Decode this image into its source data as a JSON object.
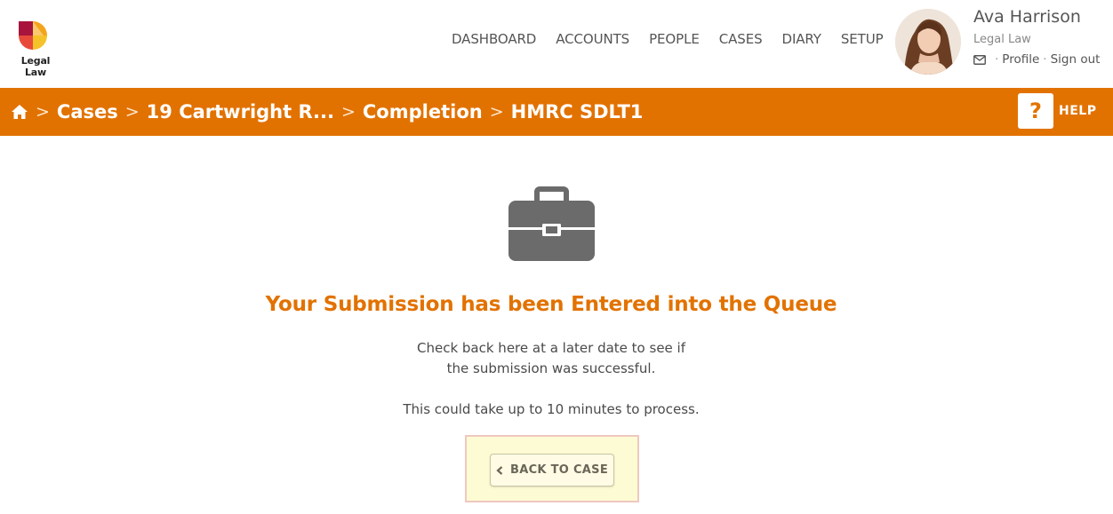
{
  "brand": {
    "name": "Legal Law"
  },
  "nav": {
    "items": [
      {
        "label": "DASHBOARD"
      },
      {
        "label": "ACCOUNTS"
      },
      {
        "label": "PEOPLE"
      },
      {
        "label": "CASES"
      },
      {
        "label": "DIARY"
      },
      {
        "label": "SETUP"
      }
    ]
  },
  "user": {
    "name": "Ava Harrison",
    "organisation": "Legal Law",
    "profile_link": "Profile",
    "separator": "·",
    "signout_link": "Sign out"
  },
  "breadcrumb": {
    "items": [
      {
        "label": "Cases"
      },
      {
        "label": "19 Cartwright R..."
      },
      {
        "label": "Completion"
      },
      {
        "label": "HMRC SDLT1"
      }
    ],
    "separator": ">"
  },
  "help": {
    "icon_text": "?",
    "label": "HELP"
  },
  "main": {
    "heading": "Your Submission has been Entered into the Queue",
    "line1": "Check back here at a later date to see if",
    "line2": "the submission was successful.",
    "line3": "This could take up to 10 minutes to process.",
    "back_button": "BACK TO CASE"
  },
  "colors": {
    "accent": "#e27200",
    "icon_gray": "#6b6b6b",
    "highlight_bg": "#fdfbd3"
  },
  "icons": [
    "home-icon",
    "mail-icon",
    "help-icon",
    "briefcase-icon",
    "chevron-left-icon"
  ]
}
